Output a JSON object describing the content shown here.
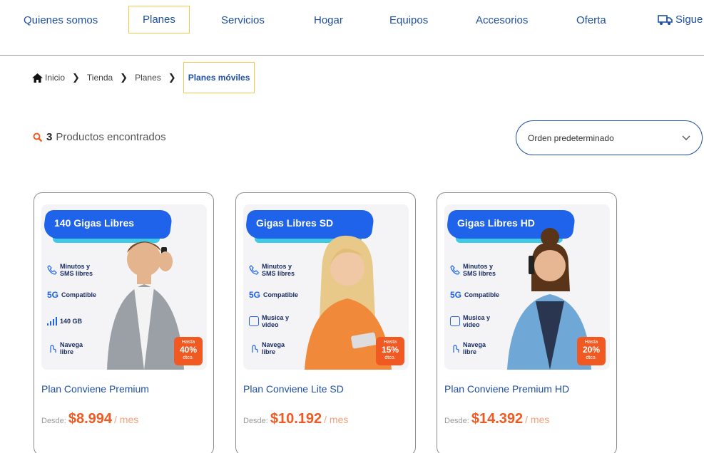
{
  "nav": {
    "items": [
      "Quienes somos",
      "Planes",
      "Servicios",
      "Hogar",
      "Equipos",
      "Accesorios",
      "Oferta"
    ],
    "follow_label": "Sigue"
  },
  "breadcrumb": {
    "items": [
      "Inicio",
      "Tienda",
      "Planes"
    ],
    "current": "Planes móviles"
  },
  "results": {
    "count": "3",
    "label": "Productos encontrados"
  },
  "sort": {
    "selected": "Orden predeterminado"
  },
  "products": [
    {
      "banner_title": "140 Gigas Libres",
      "features": [
        "Minutos y SMS libres",
        "Compatible",
        "140 GB",
        "Navega libre"
      ],
      "discount_top": "Hasta",
      "discount_pct": "40%",
      "discount_bottom": "dtco.",
      "name": "Plan Conviene Premium",
      "desde": "Desde:",
      "price": "$8.994",
      "per": "/ mes"
    },
    {
      "banner_title": "Gigas Libres SD",
      "features": [
        "Minutos y SMS libres",
        "Compatible",
        "Musica y video",
        "Navega libre"
      ],
      "discount_top": "Hasta",
      "discount_pct": "15%",
      "discount_bottom": "dtco.",
      "name": "Plan Conviene Lite SD",
      "desde": "Desde:",
      "price": "$10.192",
      "per": "/ mes"
    },
    {
      "banner_title": "Gigas Libres HD",
      "features": [
        "Minutos y SMS libres",
        "Compatible",
        "Musica y video",
        "Navega libre"
      ],
      "discount_top": "Hasta",
      "discount_pct": "20%",
      "discount_bottom": "dtco.",
      "name": "Plan Conviene Premium HD",
      "desde": "Desde:",
      "price": "$14.392",
      "per": "/ mes"
    }
  ],
  "g5_label": "5G",
  "colors": {
    "brand_blue": "#1f4fa3",
    "accent_orange": "#f05a22",
    "highlight_yellow": "#f2c94c"
  }
}
